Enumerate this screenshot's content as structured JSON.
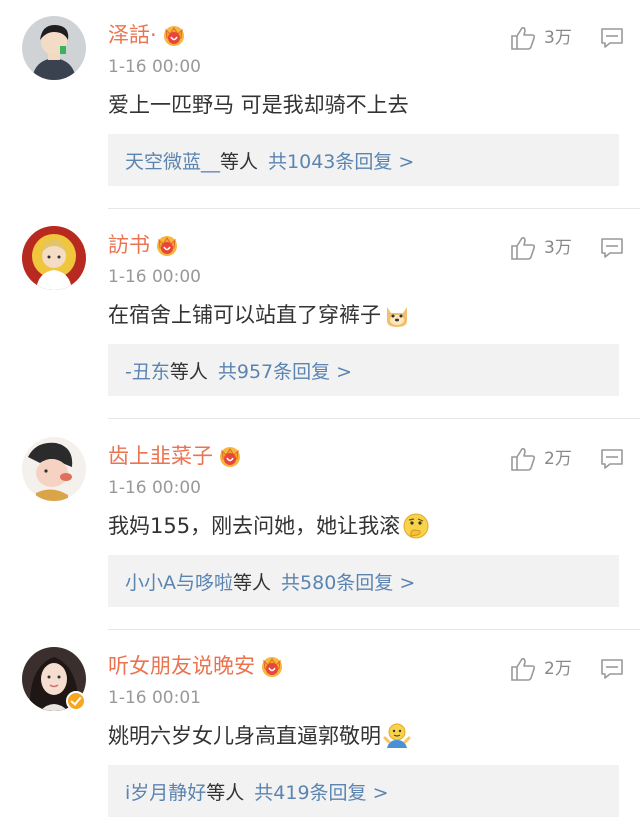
{
  "colors": {
    "username": "#eb7350",
    "link": "#5b84b1",
    "timestamp": "#999999",
    "reply_bg": "#f2f2f2"
  },
  "comments": [
    {
      "username": "泽話·",
      "time": "1-16 00:00",
      "text": "爱上一匹野马 可是我却骑不上去",
      "emoji": "",
      "likes": "3万",
      "reply_users": "天空微蓝__",
      "reply_suffix": "等人",
      "reply_count": "共1043条回复 >",
      "avatar_icon": "avatar-cartoon-man"
    },
    {
      "username": "訪书",
      "time": "1-16 00:00",
      "text": "在宿舍上铺可以站直了穿裤子",
      "emoji": "doge-emoji",
      "likes": "3万",
      "reply_users": "-丑东",
      "reply_suffix": "等人",
      "reply_count": "共957条回复 >",
      "avatar_icon": "avatar-cartoon-boy"
    },
    {
      "username": "齿上韭菜子",
      "time": "1-16 00:00",
      "text": "我妈155，刚去问她，她让我滚",
      "emoji": "thinking-emoji",
      "likes": "2万",
      "reply_users": "小小A与哆啦",
      "reply_suffix": "等人",
      "reply_count": "共580条回复 >",
      "avatar_icon": "avatar-cartoon-girl"
    },
    {
      "username": "听女朋友说晚安",
      "time": "1-16 00:01",
      "text": "姚明六岁女儿身高直逼郭敬明",
      "emoji": "shrug-emoji",
      "likes": "2万",
      "reply_users": "i岁月静好",
      "reply_suffix": "等人",
      "reply_count": "共419条回复 >",
      "avatar_icon": "avatar-photo-woman"
    }
  ]
}
